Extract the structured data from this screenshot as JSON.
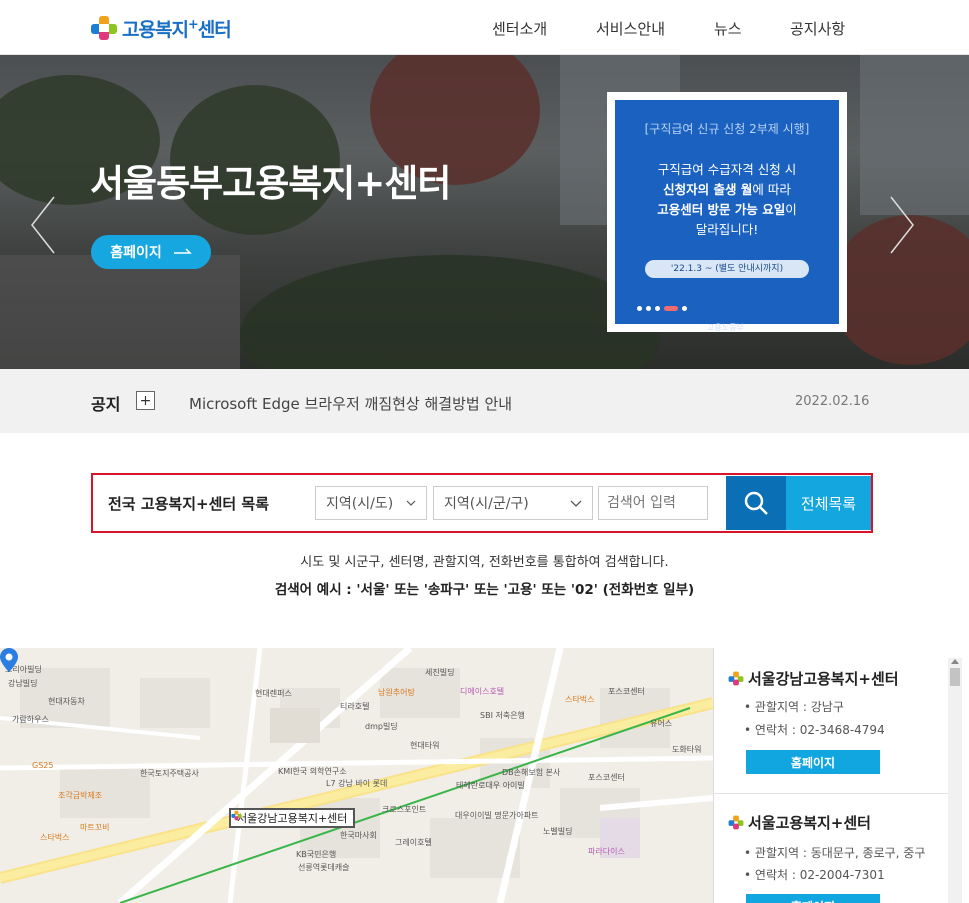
{
  "header": {
    "logo_text": "고용복지",
    "logo_plus": "+",
    "logo_suffix": "센터",
    "nav": [
      "센터소개",
      "서비스안내",
      "뉴스",
      "공지사항"
    ]
  },
  "hero": {
    "title": "서울동부고용복지+센터",
    "button_label": "홈페이지",
    "promo": {
      "tag": "[구직급여 신규 신청 2부제 시행]",
      "line1": "구직급여 수급자격 신청 시",
      "line2_bold": "신청자의 출생 월",
      "line2_rest": "에 따라",
      "line3_bold": "고용센터 방문 가능 요일",
      "line3_rest": "이",
      "line4": "달라집니다!",
      "pill": "'22.1.3 ~ (별도 안내시까지)",
      "footer": "고용노동부",
      "active_dot": 4,
      "dot_count": 5
    }
  },
  "notice": {
    "title": "공지",
    "plus": "+",
    "text": "Microsoft Edge 브라우저 깨짐현상 해결방법 안내",
    "date": "2022.02.16"
  },
  "search": {
    "label": "전국 고용복지+센터 목록",
    "select1": "지역(시/도)",
    "select2": "지역(시/군/구)",
    "placeholder": "검색어 입력",
    "all_button": "전체목록",
    "help1": "시도 및 시군구, 센터명, 관할지역, 전화번호를 통합하여 검색합니다.",
    "help2": "검색어 예시 : '서울' 또는 '송파구' 또는 '고용' 또는 '02' (전화번호 일부)"
  },
  "map": {
    "marker_label": "서울강남고용복지+센터",
    "labels": [
      "코리아빌딩",
      "강남빌딩",
      "현대자동차",
      "가람하우스",
      "GS25",
      "조각금박제조",
      "스타벅스",
      "마트꼬비",
      "현대렌퍼스",
      "세진빌딩",
      "티라호텔",
      "남원추어탕",
      "dmp빌딩",
      "디에이스호텔",
      "SBI 저축은행",
      "스타벅스",
      "포스코센터",
      "테헤란로대우 아이빌",
      "DB손해보험 본사",
      "대우이이빌 명문가아파트",
      "노벨빌딩",
      "그레이호텔",
      "KB국민은행",
      "선릉역롯데캐슬",
      "한국마사회",
      "포스코센터",
      "파라다이스",
      "크로스포인트",
      "도화타워",
      "유어스",
      "한국토지주택공사",
      "KMI한국 의학연구소",
      "L7 강남 바이 롯데",
      "현대타워"
    ]
  },
  "centers": [
    {
      "name": "서울강남고용복지+센터",
      "area_label": "관할지역 : 강남구",
      "phone_label": "연락처 : 02-3468-4794",
      "button": "홈페이지"
    },
    {
      "name": "서울고용복지+센터",
      "area_label": "관할지역 : 동대문구, 종로구, 중구",
      "phone_label": "연락처 : 02-2004-7301",
      "button": "홈페이지"
    }
  ]
}
